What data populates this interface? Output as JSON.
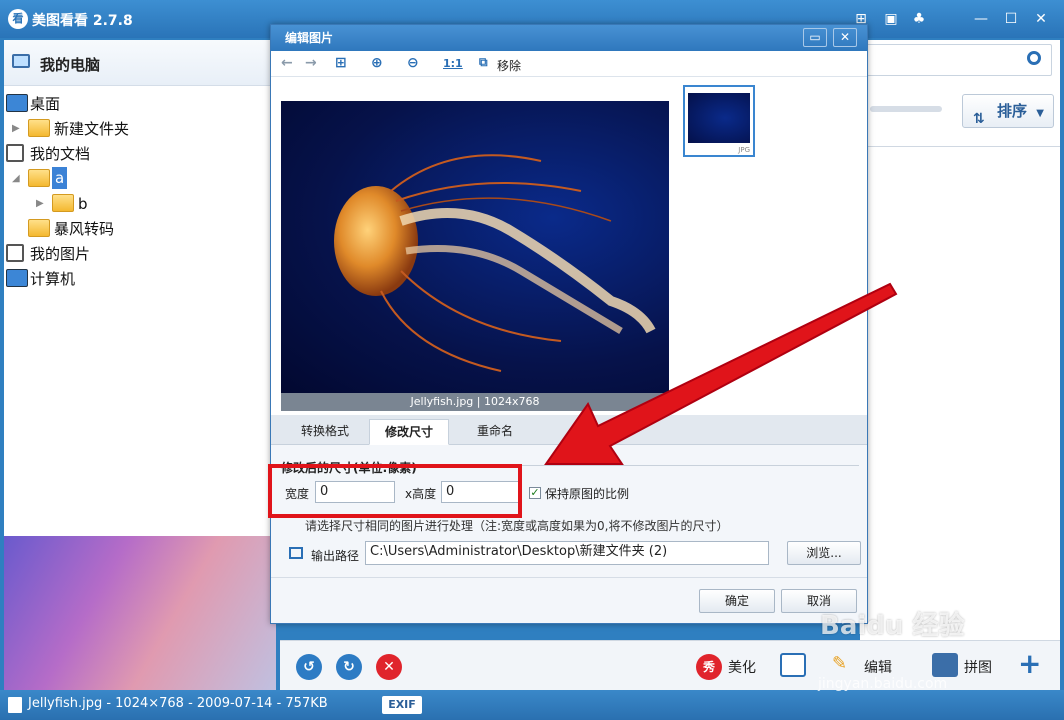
{
  "app": {
    "icon_char": "看",
    "title": "美图看看 2.7.8"
  },
  "sidebar": {
    "header": "我的电脑",
    "tree": [
      {
        "label": "桌面",
        "type": "desktop"
      },
      {
        "label": "新建文件夹",
        "type": "folder"
      },
      {
        "label": "我的文档",
        "type": "doc"
      },
      {
        "label": "a",
        "type": "folder"
      },
      {
        "label": "b",
        "type": "folder"
      },
      {
        "label": "暴风转码",
        "type": "folder"
      },
      {
        "label": "我的图片",
        "type": "doc"
      },
      {
        "label": "计算机",
        "type": "desktop"
      }
    ]
  },
  "right": {
    "sort_label": "排序"
  },
  "dialog": {
    "title": "编辑图片",
    "toolbar": {
      "ratio_label": "1:1",
      "move_label": "移除"
    },
    "preview_caption": "Jellyfish.jpg | 1024x768",
    "thumb_tag": "JPG",
    "tabs": [
      "转换格式",
      "修改尺寸",
      "重命名"
    ],
    "section_title": "修改后的尺寸(单位:像素)",
    "width_label": "宽度",
    "width_value": "0",
    "height_label": "x高度",
    "height_value": "0",
    "keep_ratio_label": "保持原图的比例",
    "hint": "请选择尺寸相同的图片进行处理（注:宽度或高度如果为0,将不修改图片的尺寸）",
    "output_label": "输出路径",
    "output_path": "C:\\Users\\Administrator\\Desktop\\新建文件夹 (2)",
    "browse_label": "浏览...",
    "ok_label": "确定",
    "cancel_label": "取消"
  },
  "bottom": {
    "beautify_label": "美化",
    "beautify_badge": "秀",
    "edit_label": "编辑",
    "puzzle_label": "拼图"
  },
  "status": {
    "text": "Jellyfish.jpg - 1024×768 - 2009-07-14 - 757KB",
    "exif": "EXIF"
  },
  "watermark": {
    "logo": "Baidu 经验",
    "url": "jingyan.baidu.com"
  },
  "colors": {
    "accent": "#2a74b8",
    "highlight": "#e0141a"
  }
}
